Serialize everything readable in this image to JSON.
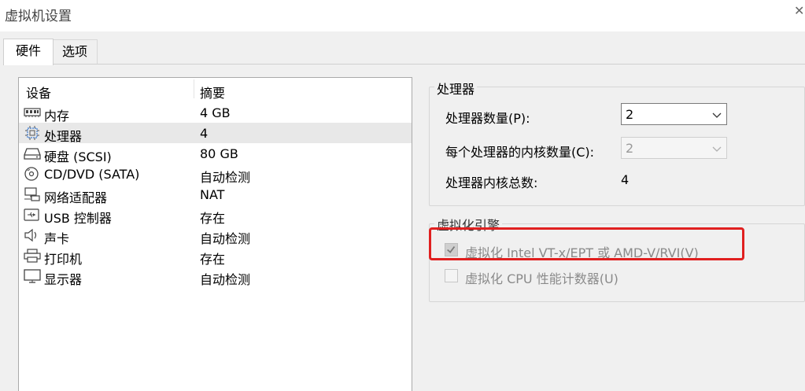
{
  "window": {
    "title": "虚拟机设置",
    "close_glyph": "✕"
  },
  "tabs": [
    {
      "label": "硬件",
      "active": true
    },
    {
      "label": "选项",
      "active": false
    }
  ],
  "device_list": {
    "columns": [
      "设备",
      "摘要"
    ],
    "rows": [
      {
        "icon": "memory-icon",
        "name": "内存",
        "summary": "4 GB",
        "selected": false
      },
      {
        "icon": "cpu-icon",
        "name": "处理器",
        "summary": "4",
        "selected": true
      },
      {
        "icon": "hard-disk-icon",
        "name": "硬盘 (SCSI)",
        "summary": "80 GB",
        "selected": false
      },
      {
        "icon": "cd-dvd-icon",
        "name": "CD/DVD (SATA)",
        "summary": "自动检测",
        "selected": false
      },
      {
        "icon": "network-adapter-icon",
        "name": "网络适配器",
        "summary": "NAT",
        "selected": false
      },
      {
        "icon": "usb-icon",
        "name": "USB 控制器",
        "summary": "存在",
        "selected": false
      },
      {
        "icon": "speaker-icon",
        "name": "声卡",
        "summary": "自动检测",
        "selected": false
      },
      {
        "icon": "printer-icon",
        "name": "打印机",
        "summary": "存在",
        "selected": false
      },
      {
        "icon": "monitor-icon",
        "name": "显示器",
        "summary": "自动检测",
        "selected": false
      }
    ]
  },
  "processor": {
    "group_title": "处理器",
    "count_label": "处理器数量(P):",
    "count_value": "2",
    "cores_label": "每个处理器的内核数量(C):",
    "cores_value": "2",
    "total_label": "处理器内核总数:",
    "total_value": "4"
  },
  "virtualization": {
    "group_title": "虚拟化引擎",
    "vtx_label": "虚拟化 Intel VT-x/EPT 或 AMD-V/RVI(V)",
    "vtx_checked": true,
    "cpu_counters_label": "虚拟化 CPU 性能计数器(U)",
    "cpu_counters_checked": false
  },
  "colors": {
    "highlight": "#e02020",
    "selected_row": "#e8e8e8"
  }
}
